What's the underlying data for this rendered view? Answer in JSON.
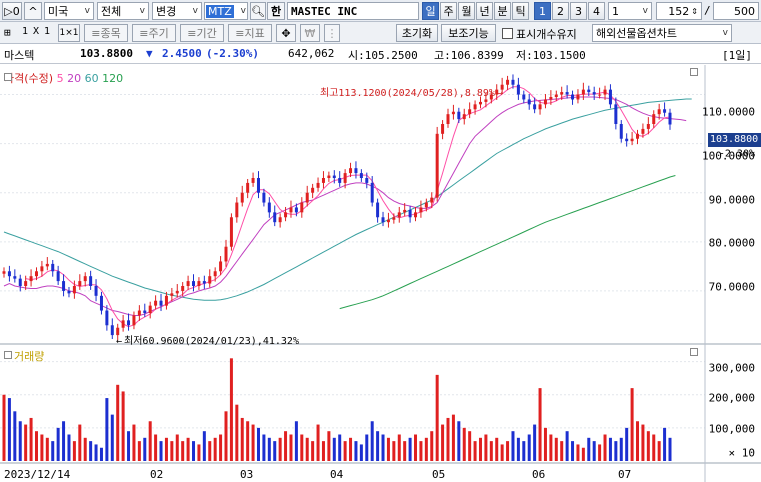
{
  "toolbar1": {
    "prev_label": "▷0",
    "market": "미국",
    "scope": "전체",
    "change": "변경",
    "symbol": "MTZ",
    "han": "한",
    "name": "MASTEC INC",
    "periods": [
      "일",
      "주",
      "월",
      "년",
      "분",
      "틱"
    ],
    "numbers": [
      "1",
      "2",
      "3",
      "4"
    ],
    "interval": "1",
    "count": "152",
    "total": "500"
  },
  "toolbar2": {
    "layout": [
      "⊞",
      "1",
      "X",
      "1",
      "1×1"
    ],
    "buttons": [
      "종목",
      "주기",
      "기간",
      "지표"
    ],
    "reset": "초기화",
    "aux": "보조기능",
    "check_label": "표시개수유지",
    "overseas": "해외선물옵션차트"
  },
  "quote": {
    "name": "마스텍",
    "price": "103.8800",
    "arrow": "▼",
    "change": "2.4500",
    "pct": "(-2.30%)",
    "volume": "642,062",
    "high_lbl": "시:105.2500",
    "open_lbl": "고:106.8399",
    "low_lbl": "저:103.1500",
    "period_label": "[1일]"
  },
  "price_panel": {
    "legend": {
      "main": "가격(수정)",
      "ma": [
        "5",
        "20",
        "60",
        "120"
      ]
    },
    "ma_colors": [
      "#ff4fa7",
      "#c040c0",
      "#3aa0a0",
      "#28a050"
    ],
    "y_ticks": [
      "110.0000",
      "100.0000",
      "90.0000",
      "80.0000",
      "70.0000"
    ],
    "current_price": "103.8800",
    "current_pct": "-2.30%",
    "high_note": "최고113.1200(2024/05/28),8.89%",
    "low_note": "최저60.9600(2024/01/23),41.32%"
  },
  "volume_panel": {
    "legend": "거래량",
    "y_ticks": [
      "300,000",
      "200,000",
      "100,000"
    ],
    "unit": "× 10"
  },
  "x_axis": [
    "2023/12/14",
    "02",
    "03",
    "04",
    "05",
    "06",
    "07"
  ],
  "chart_data": {
    "type": "candlestick",
    "y_range": [
      60,
      115
    ],
    "closes": [
      74,
      73,
      72.5,
      71,
      72,
      73,
      74,
      75,
      75.5,
      74,
      72,
      70,
      69.5,
      71,
      72,
      73,
      71,
      69,
      66,
      63,
      61,
      62.5,
      64,
      63,
      65,
      66,
      65.5,
      67,
      68,
      67,
      69,
      69.5,
      70,
      71,
      72,
      71,
      72,
      71.5,
      73,
      74,
      76,
      79,
      85,
      88,
      90,
      92,
      93,
      90,
      88,
      86,
      84,
      85,
      86,
      87,
      86,
      88,
      90,
      91,
      92,
      93,
      93.5,
      93,
      92,
      94,
      95,
      94,
      93,
      92,
      88,
      85,
      84,
      84.5,
      85,
      86,
      86.5,
      85,
      86,
      87,
      88,
      89,
      102,
      104,
      106,
      106.5,
      105,
      106,
      107,
      108,
      108.5,
      109,
      110,
      111,
      112,
      113,
      112,
      110,
      109,
      108,
      107,
      108,
      109,
      109.5,
      110,
      110.5,
      110,
      109,
      110,
      111,
      110.5,
      110,
      110,
      111,
      108,
      104,
      101,
      100.5,
      101,
      102,
      103,
      104,
      106,
      107,
      106.3,
      103.9
    ],
    "volumes": [
      200,
      190,
      150,
      120,
      110,
      130,
      90,
      80,
      70,
      60,
      100,
      120,
      80,
      60,
      110,
      70,
      60,
      50,
      40,
      190,
      140,
      230,
      210,
      90,
      110,
      60,
      70,
      120,
      80,
      60,
      70,
      60,
      80,
      60,
      70,
      60,
      50,
      90,
      60,
      70,
      80,
      150,
      310,
      170,
      130,
      120,
      110,
      100,
      80,
      70,
      60,
      70,
      90,
      80,
      120,
      80,
      70,
      60,
      110,
      60,
      90,
      70,
      80,
      60,
      70,
      60,
      50,
      80,
      120,
      90,
      80,
      70,
      60,
      80,
      60,
      70,
      80,
      60,
      70,
      90,
      260,
      110,
      130,
      140,
      120,
      100,
      90,
      60,
      70,
      80,
      60,
      70,
      50,
      60,
      90,
      70,
      60,
      80,
      110,
      220,
      100,
      80,
      70,
      60,
      90,
      60,
      50,
      40,
      70,
      60,
      50,
      80,
      70,
      60,
      70,
      100,
      220,
      120,
      110,
      90,
      80,
      60,
      100,
      70,
      60,
      90,
      100,
      60
    ],
    "ma20": [
      71,
      71.5,
      71,
      70.8,
      70.6,
      70.5,
      70.5,
      70.8,
      71,
      71,
      70.8,
      70.5,
      70,
      69.8,
      69.5,
      69,
      68,
      67.5,
      67,
      66.5,
      66,
      65.8,
      65.5,
      65.2,
      65,
      65,
      65.3,
      65.8,
      66.3,
      66.8,
      67.3,
      67.8,
      68.3,
      68.8,
      69.3,
      69.6,
      70,
      70.3,
      70.6,
      71,
      71.8,
      73,
      74.5,
      76,
      77.5,
      79,
      80.5,
      82,
      83.5,
      84.5,
      85.5,
      86,
      86.5,
      87,
      87.5,
      88,
      88.3,
      88.5,
      89,
      89.5,
      90,
      90.5,
      91,
      91.5,
      91.8,
      92,
      92,
      91.8,
      91.3,
      90.8,
      90,
      89,
      88.3,
      87.8,
      87.5,
      87.3,
      87,
      86.8,
      86.8,
      87.2,
      88,
      90,
      92,
      94,
      96,
      98,
      100,
      101.5,
      102.5,
      103.5,
      104.5,
      105.5,
      106.3,
      107,
      107.5,
      108,
      108.3,
      108.5,
      108.7,
      108.8,
      108.9,
      109,
      109.1,
      109.2,
      109.3,
      109.4,
      109.5,
      109.5,
      109.5,
      109.5,
      109.4,
      109.3,
      109.2,
      109,
      108.5,
      108,
      107.3,
      106.7,
      106.2,
      105.8,
      105.5,
      105.3,
      105.2,
      105.1,
      105,
      104.9,
      104.7
    ],
    "ma60": [
      82,
      81.6,
      81.2,
      80.8,
      80.4,
      80,
      79.6,
      79.2,
      78.8,
      78.4,
      78,
      77.5,
      77,
      76.5,
      76,
      75.5,
      75,
      74.5,
      74,
      73.5,
      73,
      72.6,
      72.2,
      71.8,
      71.4,
      71,
      70.6,
      70.3,
      70,
      69.7,
      69.4,
      69.1,
      68.9,
      68.7,
      68.5,
      68.3,
      68.2,
      68.1,
      68.1,
      68.1,
      68.2,
      68.4,
      68.7,
      69,
      69.4,
      69.8,
      70.3,
      70.8,
      71.3,
      71.9,
      72.5,
      73.1,
      73.7,
      74.3,
      74.9,
      75.5,
      76.1,
      76.7,
      77.3,
      77.9,
      78.5,
      79.1,
      79.7,
      80.3,
      80.9,
      81.5,
      82,
      82.5,
      83,
      83.5,
      84,
      84.5,
      85,
      85.5,
      86,
      86.5,
      87,
      87.5,
      88,
      88.5,
      89.2,
      90,
      90.8,
      91.6,
      92.4,
      93.2,
      94,
      94.8,
      95.6,
      96.4,
      97.2,
      98,
      98.6,
      99.2,
      99.8,
      100.4,
      101,
      101.5,
      102,
      102.5,
      103,
      103.4,
      103.8,
      104.2,
      104.6,
      105,
      105.3,
      105.6,
      105.9,
      106.2,
      106.5,
      106.8,
      107,
      107.2,
      107.4,
      107.6,
      107.8,
      108,
      108.2,
      108.4,
      108.5,
      108.6,
      108.7,
      108.8,
      108.9,
      109,
      109.1,
      109.1
    ],
    "ma120": [
      null,
      null,
      null,
      null,
      null,
      null,
      null,
      null,
      null,
      null,
      null,
      null,
      null,
      null,
      null,
      null,
      null,
      null,
      null,
      null,
      null,
      null,
      null,
      null,
      null,
      null,
      null,
      null,
      null,
      null,
      null,
      null,
      null,
      null,
      null,
      null,
      null,
      null,
      null,
      null,
      null,
      null,
      null,
      null,
      null,
      null,
      null,
      null,
      null,
      null,
      null,
      null,
      null,
      null,
      null,
      null,
      null,
      null,
      null,
      null,
      null,
      null,
      66.4,
      66.7,
      67,
      67.3,
      67.6,
      67.9,
      68.2,
      68.6,
      69,
      69.5,
      70,
      70.5,
      71,
      71.5,
      72,
      72.5,
      73,
      73.5,
      74,
      74.5,
      75,
      75.5,
      76,
      76.5,
      77,
      77.5,
      78,
      78.5,
      79,
      79.5,
      80,
      80.5,
      81,
      81.5,
      82,
      82.5,
      83,
      83.5,
      84,
      84.4,
      84.8,
      85.2,
      85.6,
      86,
      86.4,
      86.8,
      87.2,
      87.6,
      88,
      88.4,
      88.8,
      89.2,
      89.6,
      90,
      90.4,
      90.8,
      91.2,
      91.6,
      92,
      92.4,
      92.8,
      93.2,
      93.5
    ]
  }
}
